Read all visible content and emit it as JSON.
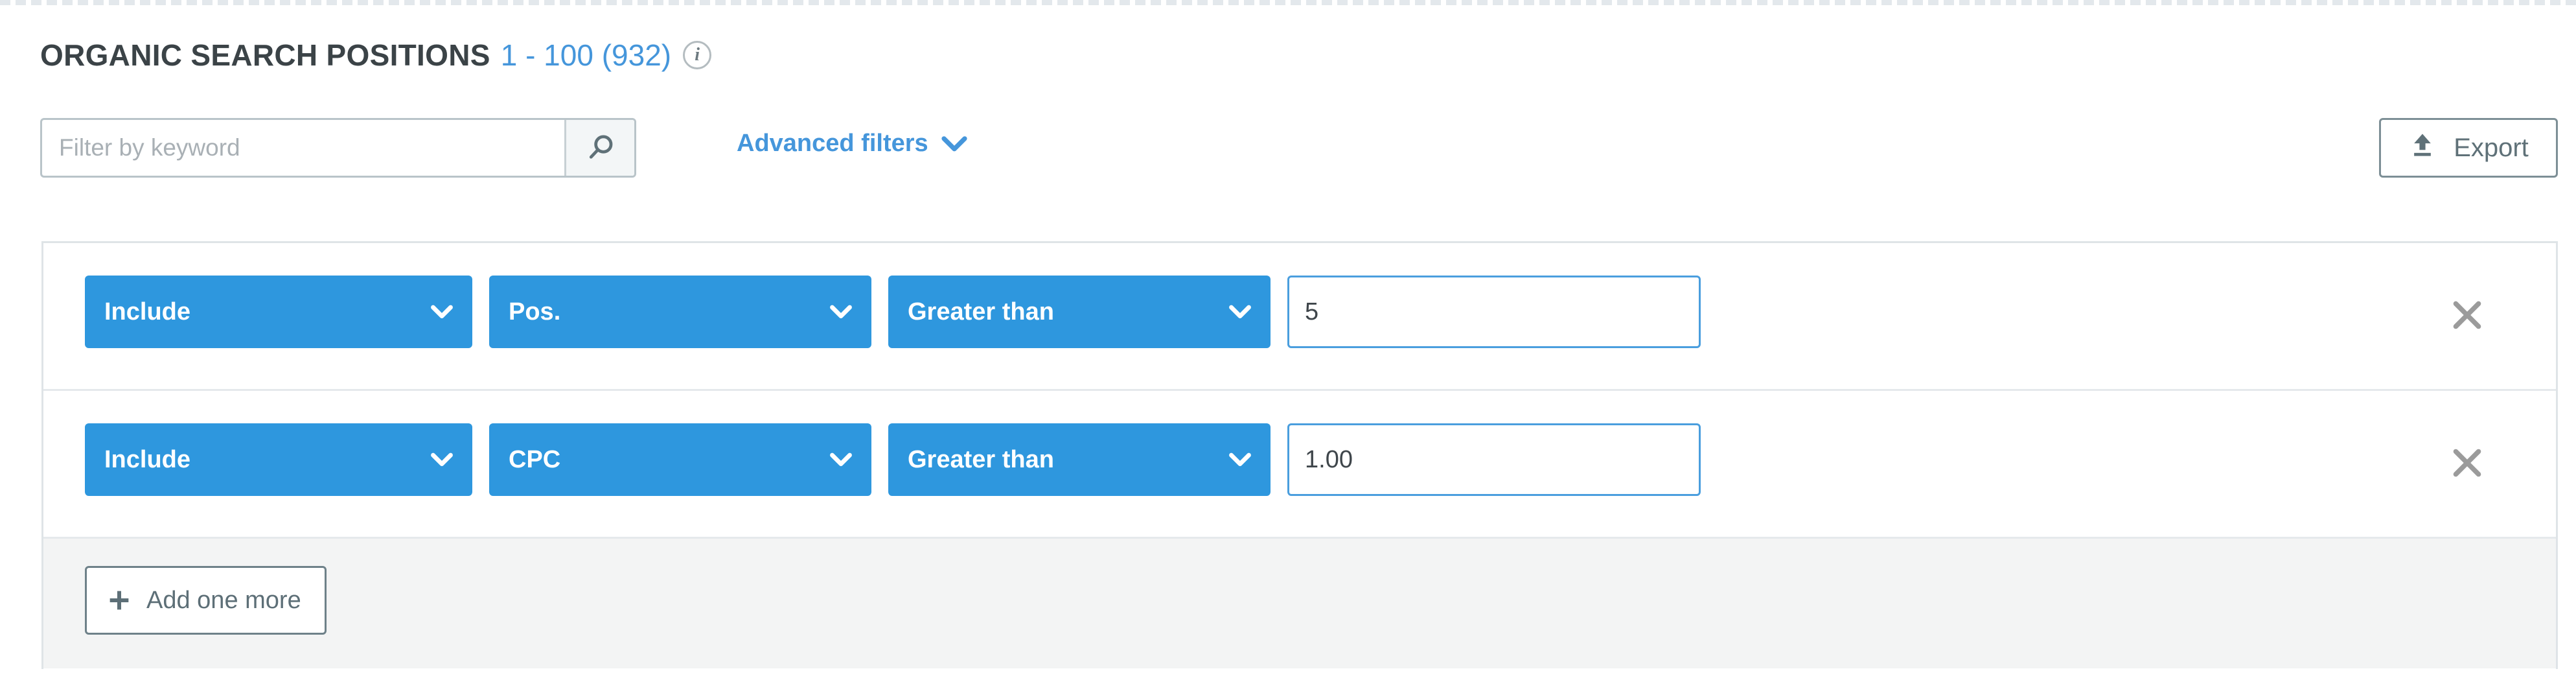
{
  "header": {
    "title": "ORGANIC SEARCH POSITIONS",
    "range_count": "1 - 100 (932)",
    "info_glyph": "i"
  },
  "toolbar": {
    "search_placeholder": "Filter by keyword",
    "search_value": "",
    "search_icon": "search-icon",
    "advanced_filters_label": "Advanced filters",
    "advanced_filters_chevron": "chevron-down-icon",
    "export_label": "Export",
    "export_icon": "upload-icon"
  },
  "filter_panel": {
    "rows": [
      {
        "operator": "Include",
        "field": "Pos.",
        "condition": "Greater than",
        "value": "5",
        "remove_icon": "close-icon"
      },
      {
        "operator": "Include",
        "field": "CPC",
        "condition": "Greater than",
        "value": "1.00",
        "remove_icon": "close-icon"
      }
    ],
    "add_more_label": "Add one more",
    "add_more_icon": "plus-icon"
  },
  "colors": {
    "accent_blue": "#2e97de",
    "link_blue": "#4596db",
    "title_gray": "#3b4347",
    "slate": "#5f7178",
    "panel_border": "#dfe4e7",
    "footer_bg": "#f3f4f4"
  }
}
